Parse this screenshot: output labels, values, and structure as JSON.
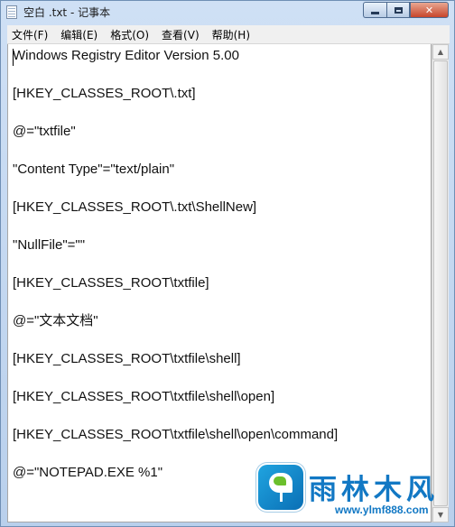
{
  "window": {
    "title": "空白 .txt - 记事本",
    "icon": "notepad-icon",
    "buttons": {
      "minimize": "minimize-icon",
      "maximize": "maximize-icon",
      "close_glyph": "✕"
    }
  },
  "menu": {
    "items": [
      {
        "label": "文件(F)"
      },
      {
        "label": "编辑(E)"
      },
      {
        "label": "格式(O)"
      },
      {
        "label": "查看(V)"
      },
      {
        "label": "帮助(H)"
      }
    ]
  },
  "editor": {
    "lines": [
      "Windows Registry Editor Version 5.00",
      "[HKEY_CLASSES_ROOT\\.txt]",
      "@=\"txtfile\"",
      "\"Content Type\"=\"text/plain\"",
      "[HKEY_CLASSES_ROOT\\.txt\\ShellNew]",
      "\"NullFile\"=\"\"",
      "[HKEY_CLASSES_ROOT\\txtfile]",
      "@=\"文本文档\"",
      "[HKEY_CLASSES_ROOT\\txtfile\\shell]",
      "[HKEY_CLASSES_ROOT\\txtfile\\shell\\open]",
      "[HKEY_CLASSES_ROOT\\txtfile\\shell\\open\\command]",
      "@=\"NOTEPAD.EXE %1\""
    ]
  },
  "scrollbar": {
    "up_glyph": "▲",
    "down_glyph": "▼"
  },
  "watermark": {
    "title": "雨林木风",
    "url": "www.ylmf888.com",
    "logo": "ylmf-logo-icon"
  }
}
